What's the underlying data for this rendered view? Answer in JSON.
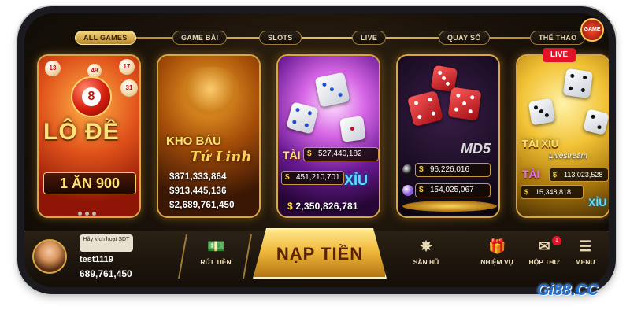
{
  "tabs": [
    "ALL GAMES",
    "GAME BÀI",
    "SLOTS",
    "LIVE",
    "QUAY SỐ",
    "THỂ THAO"
  ],
  "corner_badge": "GAME",
  "cards": {
    "lode": {
      "title": "LÔ ĐỀ",
      "ball_number": "8",
      "promo": "1 ĂN 900",
      "small_balls": [
        "49",
        "13",
        "17",
        "31"
      ]
    },
    "khobau": {
      "title_top": "KHO BÁU",
      "title_bottom": "Tứ Linh",
      "jackpots": [
        "$871,333,864",
        "$913,445,136",
        "$2,689,761,450"
      ]
    },
    "taixiu": {
      "tai_label": "TÀI",
      "xiu_label": "XỈU",
      "tai_amount": "527,440,182",
      "xiu_amount": "451,210,701",
      "total": "2,350,826,781"
    },
    "md5": {
      "label": "MD5",
      "amounts": [
        "96,226,016",
        "154,025,067"
      ]
    },
    "livestream": {
      "live_badge": "LIVE",
      "title": "TÀI XỈU",
      "subtitle": "Livestream",
      "tai_label": "TÀI",
      "xiu_label": "XỈU",
      "amounts": [
        "113,023,528",
        "15,348,818"
      ]
    }
  },
  "user": {
    "verify_text": "Hãy kích hoạt SDT",
    "username": "test1119",
    "balance": "689,761,450"
  },
  "nav": {
    "ruttien": "RÚT TIỀN",
    "naptien": "NẠP TIỀN",
    "sanhu": "SĂN HŨ",
    "nhiemvu": "NHIỆM VỤ",
    "hopthu": "HỘP THƯ",
    "hopthu_count": "1",
    "menu": "MENU"
  },
  "watermark": "Gi88.CC"
}
